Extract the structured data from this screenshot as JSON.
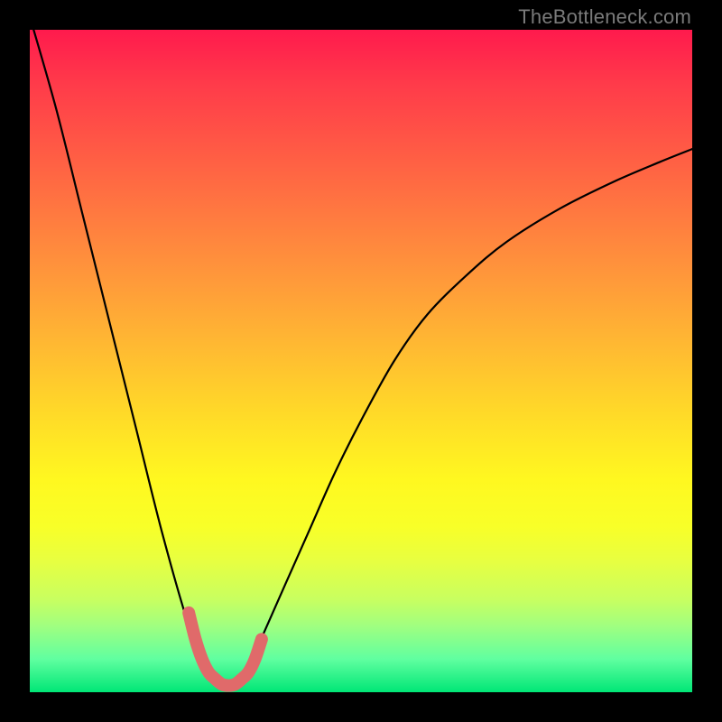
{
  "watermark": "TheBottleneck.com",
  "chart_data": {
    "type": "line",
    "title": "",
    "xlabel": "",
    "ylabel": "",
    "xlim": [
      0,
      100
    ],
    "ylim": [
      0,
      100
    ],
    "series": [
      {
        "name": "bottleneck-curve",
        "x": [
          0,
          4,
          8,
          12,
          16,
          20,
          24,
          26,
          28,
          30,
          32,
          34,
          38,
          42,
          46,
          50,
          55,
          60,
          66,
          72,
          80,
          88,
          95,
          100
        ],
        "values": [
          102,
          88,
          72,
          56,
          40,
          24,
          10,
          5,
          2,
          1,
          2,
          6,
          15,
          24,
          33,
          41,
          50,
          57,
          63,
          68,
          73,
          77,
          80,
          82
        ]
      },
      {
        "name": "optimal-marker",
        "x": [
          24,
          25,
          26,
          27,
          28,
          29,
          30,
          31,
          32,
          33,
          34,
          35
        ],
        "values": [
          12,
          8,
          5,
          3,
          2,
          1.2,
          1,
          1.2,
          2,
          3,
          5,
          8
        ]
      }
    ],
    "colors": {
      "curve": "#000000",
      "marker": "#e06a6a",
      "background_gradient_top": "#ff1a4d",
      "background_gradient_bottom": "#00e676"
    },
    "annotations": []
  }
}
